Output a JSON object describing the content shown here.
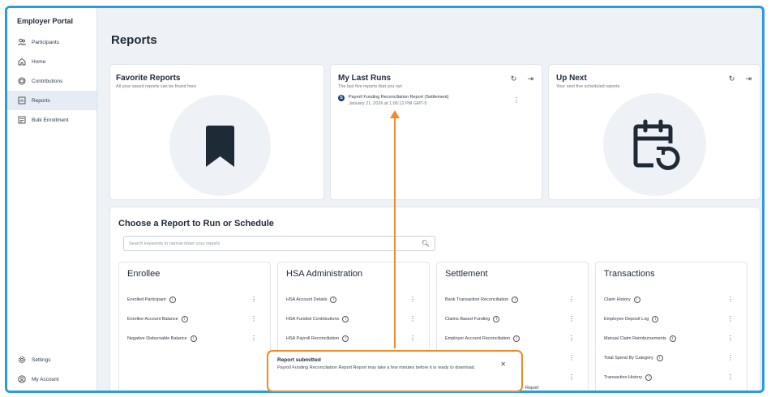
{
  "sidebar": {
    "title": "Employer Portal",
    "items": [
      {
        "label": "Participants",
        "icon": "participants-icon"
      },
      {
        "label": "Home",
        "icon": "home-icon"
      },
      {
        "label": "Contributions",
        "icon": "contributions-icon"
      },
      {
        "label": "Reports",
        "icon": "reports-icon",
        "active": true
      },
      {
        "label": "Bulk Enrollment",
        "icon": "bulk-enrollment-icon"
      }
    ],
    "bottom": [
      {
        "label": "Settings",
        "icon": "gear-icon"
      },
      {
        "label": "My Account",
        "icon": "account-icon"
      }
    ]
  },
  "page": {
    "title": "Reports"
  },
  "favorites": {
    "title": "Favorite Reports",
    "subtitle": "All your saved reports can be found here"
  },
  "last_runs": {
    "title": "My Last Runs",
    "subtitle": "The last five reports that you ran",
    "items": [
      {
        "title": "Payroll Funding Reconciliation Report (Settlement)",
        "time": "January 21, 2026 at 1:06:12 PM GMT-5"
      }
    ]
  },
  "up_next": {
    "title": "Up Next",
    "subtitle": "Your next five scheduled reports"
  },
  "choose": {
    "title": "Choose a Report to Run or Schedule",
    "search_placeholder": "Search keywords to narrow down your reports"
  },
  "categories": [
    {
      "title": "Enrollee",
      "reports": [
        "Enrolled Participant",
        "Enrollee Account Balance",
        "Negative Disbursable Balance"
      ]
    },
    {
      "title": "HSA Administration",
      "reports": [
        "HSA Account Details",
        "HSA Funded Contributions",
        "HSA Payroll Reconciliation"
      ]
    },
    {
      "title": "Settlement",
      "reports": [
        "Bank Transaction Reconciliation",
        "Claims Based Funding",
        "Employer Account Reconciliation"
      ]
    },
    {
      "title": "Transactions",
      "reports": [
        "Claim History",
        "Employee Deposit Log",
        "Manual Claim Reimbursements",
        "Total Spend By Category",
        "Transaction History"
      ]
    }
  ],
  "toast": {
    "title": "Report submitted",
    "message": "Payroll Funding Reconciliation Report Report may take a few minutes before it is ready to download.",
    "hidden_peek_text": "Report"
  },
  "colors": {
    "accent_border": "#2b9be0",
    "highlight": "#f08a24",
    "brand": "#1f3f73"
  }
}
